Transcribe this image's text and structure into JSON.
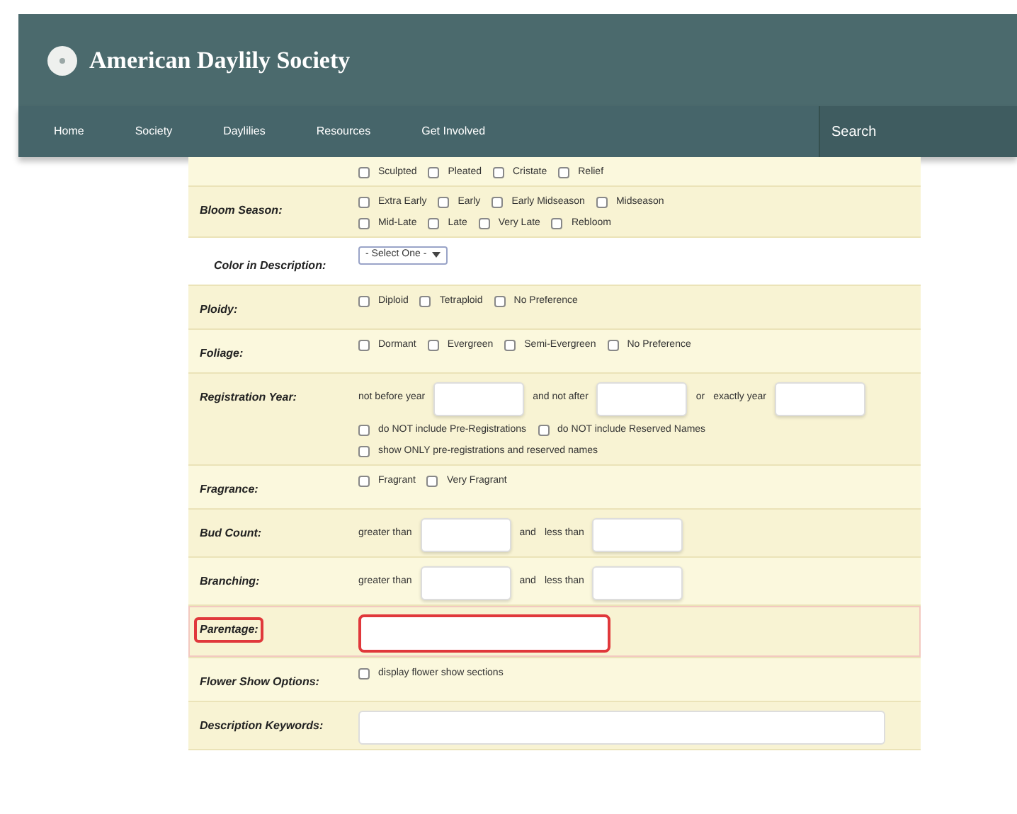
{
  "header": {
    "title": "American Daylily Society",
    "nav": [
      {
        "label": "Home"
      },
      {
        "label": "Society"
      },
      {
        "label": "Daylilies"
      },
      {
        "label": "Resources"
      },
      {
        "label": "Get Involved"
      }
    ],
    "search": {
      "placeholder": "Search"
    }
  },
  "form": {
    "rows": [
      {
        "plain": false,
        "highlighted": false,
        "lines": [
          [
            {
              "kind": "checkbox",
              "label": "Sculpted",
              "checked": false
            },
            {
              "kind": "checkbox",
              "label": "Pleated",
              "checked": false
            },
            {
              "kind": "checkbox",
              "label": "Cristate",
              "checked": false
            },
            {
              "kind": "checkbox",
              "label": "Relief",
              "checked": false
            }
          ]
        ]
      },
      {
        "label": "Bloom Season:",
        "plain": false,
        "highlighted": false,
        "lines": [
          [
            {
              "kind": "checkbox",
              "label": "Extra Early",
              "checked": false
            },
            {
              "kind": "checkbox",
              "label": "Early",
              "checked": false
            },
            {
              "kind": "checkbox",
              "label": "Early Midseason",
              "checked": false
            },
            {
              "kind": "checkbox",
              "label": "Midseason",
              "checked": false
            }
          ],
          [
            {
              "kind": "checkbox",
              "label": "Mid-Late",
              "checked": false
            },
            {
              "kind": "checkbox",
              "label": "Late",
              "checked": false
            },
            {
              "kind": "checkbox",
              "label": "Very Late",
              "checked": false
            },
            {
              "kind": "checkbox",
              "label": "Rebloom",
              "checked": false
            }
          ]
        ]
      },
      {
        "label": "Color in Description:",
        "plain": true,
        "highlighted": false,
        "lines": [
          [
            {
              "kind": "select",
              "value": "- Select One -"
            }
          ]
        ]
      },
      {
        "label": "Ploidy:",
        "plain": false,
        "highlighted": false,
        "lines": [
          [
            {
              "kind": "checkbox",
              "label": "Diploid",
              "checked": false
            },
            {
              "kind": "checkbox",
              "label": "Tetraploid",
              "checked": false
            },
            {
              "kind": "checkbox",
              "label": "No Preference",
              "checked": false
            }
          ]
        ]
      },
      {
        "label": "Foliage:",
        "plain": false,
        "highlighted": false,
        "lines": [
          [
            {
              "kind": "checkbox",
              "label": "Dormant",
              "checked": false
            },
            {
              "kind": "checkbox",
              "label": "Evergreen",
              "checked": false
            },
            {
              "kind": "checkbox",
              "label": "Semi-Evergreen",
              "checked": false
            },
            {
              "kind": "checkbox",
              "label": "No Preference",
              "checked": false
            }
          ]
        ]
      },
      {
        "label": "Registration Year:",
        "plain": false,
        "highlighted": false,
        "lines": [
          [
            {
              "kind": "text",
              "text": "not before year"
            },
            {
              "kind": "input"
            },
            {
              "kind": "text",
              "text": "and not after"
            },
            {
              "kind": "input"
            },
            {
              "kind": "text",
              "text": "or"
            },
            {
              "kind": "text",
              "text": "exactly year"
            },
            {
              "kind": "input"
            }
          ],
          [
            {
              "kind": "checkbox",
              "label": "do NOT include Pre-Registrations",
              "checked": false
            },
            {
              "kind": "checkbox",
              "label": "do NOT include Reserved Names",
              "checked": false
            }
          ],
          [
            {
              "kind": "checkbox",
              "label": "show ONLY pre-registrations and reserved names",
              "checked": false
            }
          ]
        ]
      },
      {
        "label": "Fragrance:",
        "plain": false,
        "highlighted": false,
        "lines": [
          [
            {
              "kind": "checkbox",
              "label": "Fragrant",
              "checked": false
            },
            {
              "kind": "checkbox",
              "label": "Very Fragrant",
              "checked": false
            }
          ]
        ]
      },
      {
        "label": "Bud Count:",
        "plain": false,
        "highlighted": false,
        "lines": [
          [
            {
              "kind": "text",
              "text": "greater than"
            },
            {
              "kind": "input"
            },
            {
              "kind": "text",
              "text": "and"
            },
            {
              "kind": "text",
              "text": "less than"
            },
            {
              "kind": "input"
            }
          ]
        ]
      },
      {
        "label": "Branching:",
        "plain": false,
        "highlighted": false,
        "lines": [
          [
            {
              "kind": "text",
              "text": "greater than"
            },
            {
              "kind": "input"
            },
            {
              "kind": "text",
              "text": "and"
            },
            {
              "kind": "text",
              "text": "less than"
            },
            {
              "kind": "input"
            }
          ]
        ]
      },
      {
        "label": "Parentage:",
        "plain": false,
        "highlighted": true,
        "lines": [
          [
            {
              "kind": "long_input"
            }
          ]
        ]
      },
      {
        "label": "Flower Show Options:",
        "plain": false,
        "highlighted": false,
        "lines": [
          [
            {
              "kind": "checkbox",
              "label": "display flower show sections",
              "checked": false
            }
          ]
        ]
      },
      {
        "label": "Description Keywords:",
        "plain": false,
        "highlighted": false,
        "lines": [
          [
            {
              "kind": "wide_input"
            }
          ]
        ]
      }
    ]
  }
}
